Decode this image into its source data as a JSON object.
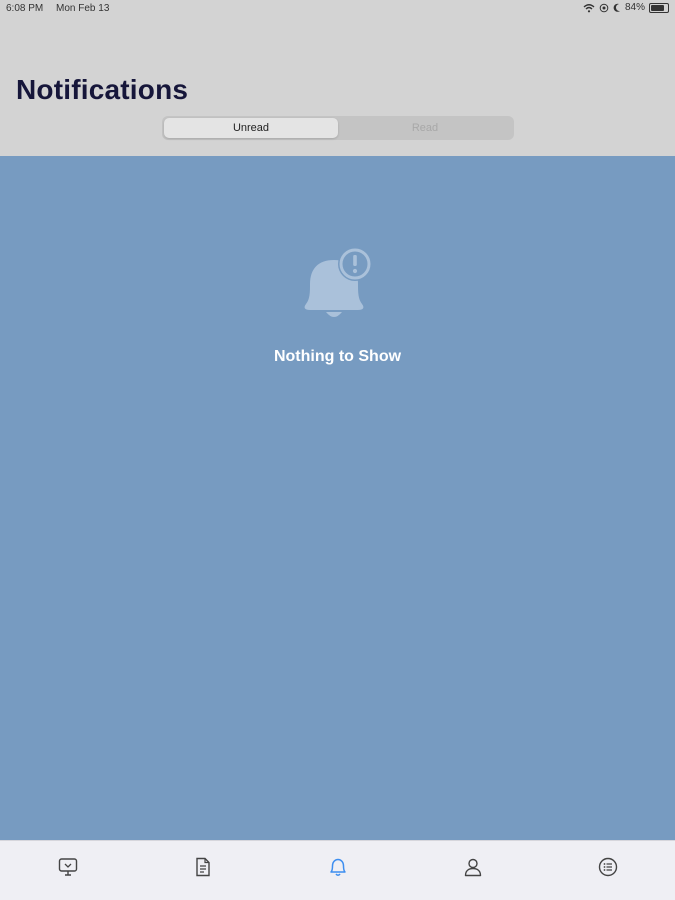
{
  "status_bar": {
    "time": "6:08 PM",
    "date": "Mon Feb 13",
    "battery": "84%",
    "battery_level": 0.84,
    "icons": [
      "wifi-icon",
      "focus-icon",
      "moon-icon",
      "battery-icon"
    ]
  },
  "header": {
    "title": "Notifications"
  },
  "segmented_control": {
    "options": [
      "Unread",
      "Read"
    ],
    "selected": "Unread"
  },
  "empty_state": {
    "icon": "bell-alert-icon",
    "message": "Nothing to Show"
  },
  "tab_bar": {
    "items": [
      {
        "icon": "display-icon",
        "active": false
      },
      {
        "icon": "document-icon",
        "active": false
      },
      {
        "icon": "bell-icon",
        "active": true
      },
      {
        "icon": "person-icon",
        "active": false
      },
      {
        "icon": "list-icon",
        "active": false
      }
    ]
  },
  "colors": {
    "header_bg": "#d3d3d3",
    "content_bg": "#779bc1",
    "title": "#16163a",
    "tab_active": "#3d8ef0",
    "tab_inactive": "#444444"
  }
}
